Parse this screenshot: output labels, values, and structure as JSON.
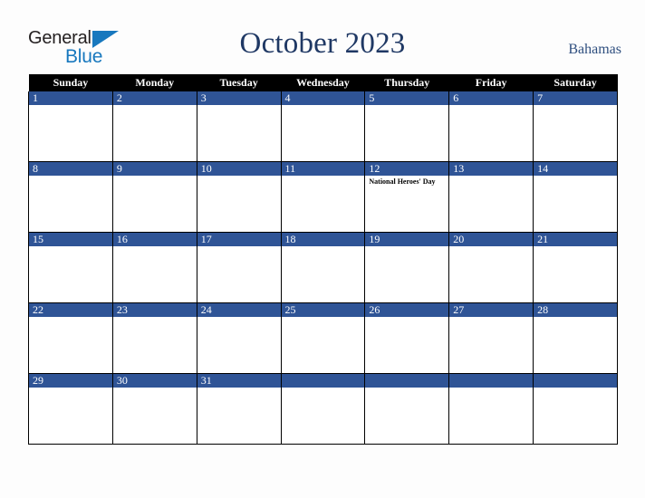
{
  "brand": {
    "name_part1": "General",
    "name_part2": "Blue",
    "triangle_color": "#1878be",
    "text_color": "#231f20"
  },
  "header": {
    "title": "October 2023",
    "country": "Bahamas",
    "title_color": "#1f3864"
  },
  "calendar": {
    "weekday_headers": [
      "Sunday",
      "Monday",
      "Tuesday",
      "Wednesday",
      "Thursday",
      "Friday",
      "Saturday"
    ],
    "header_bg": "#000000",
    "daynum_bg": "#2f5496",
    "weeks": [
      [
        {
          "day": "1",
          "events": []
        },
        {
          "day": "2",
          "events": []
        },
        {
          "day": "3",
          "events": []
        },
        {
          "day": "4",
          "events": []
        },
        {
          "day": "5",
          "events": []
        },
        {
          "day": "6",
          "events": []
        },
        {
          "day": "7",
          "events": []
        }
      ],
      [
        {
          "day": "8",
          "events": []
        },
        {
          "day": "9",
          "events": []
        },
        {
          "day": "10",
          "events": []
        },
        {
          "day": "11",
          "events": []
        },
        {
          "day": "12",
          "events": [
            "National Heroes' Day"
          ]
        },
        {
          "day": "13",
          "events": []
        },
        {
          "day": "14",
          "events": []
        }
      ],
      [
        {
          "day": "15",
          "events": []
        },
        {
          "day": "16",
          "events": []
        },
        {
          "day": "17",
          "events": []
        },
        {
          "day": "18",
          "events": []
        },
        {
          "day": "19",
          "events": []
        },
        {
          "day": "20",
          "events": []
        },
        {
          "day": "21",
          "events": []
        }
      ],
      [
        {
          "day": "22",
          "events": []
        },
        {
          "day": "23",
          "events": []
        },
        {
          "day": "24",
          "events": []
        },
        {
          "day": "25",
          "events": []
        },
        {
          "day": "26",
          "events": []
        },
        {
          "day": "27",
          "events": []
        },
        {
          "day": "28",
          "events": []
        }
      ],
      [
        {
          "day": "29",
          "events": []
        },
        {
          "day": "30",
          "events": []
        },
        {
          "day": "31",
          "events": []
        },
        {
          "day": "",
          "events": []
        },
        {
          "day": "",
          "events": []
        },
        {
          "day": "",
          "events": []
        },
        {
          "day": "",
          "events": []
        }
      ]
    ]
  }
}
